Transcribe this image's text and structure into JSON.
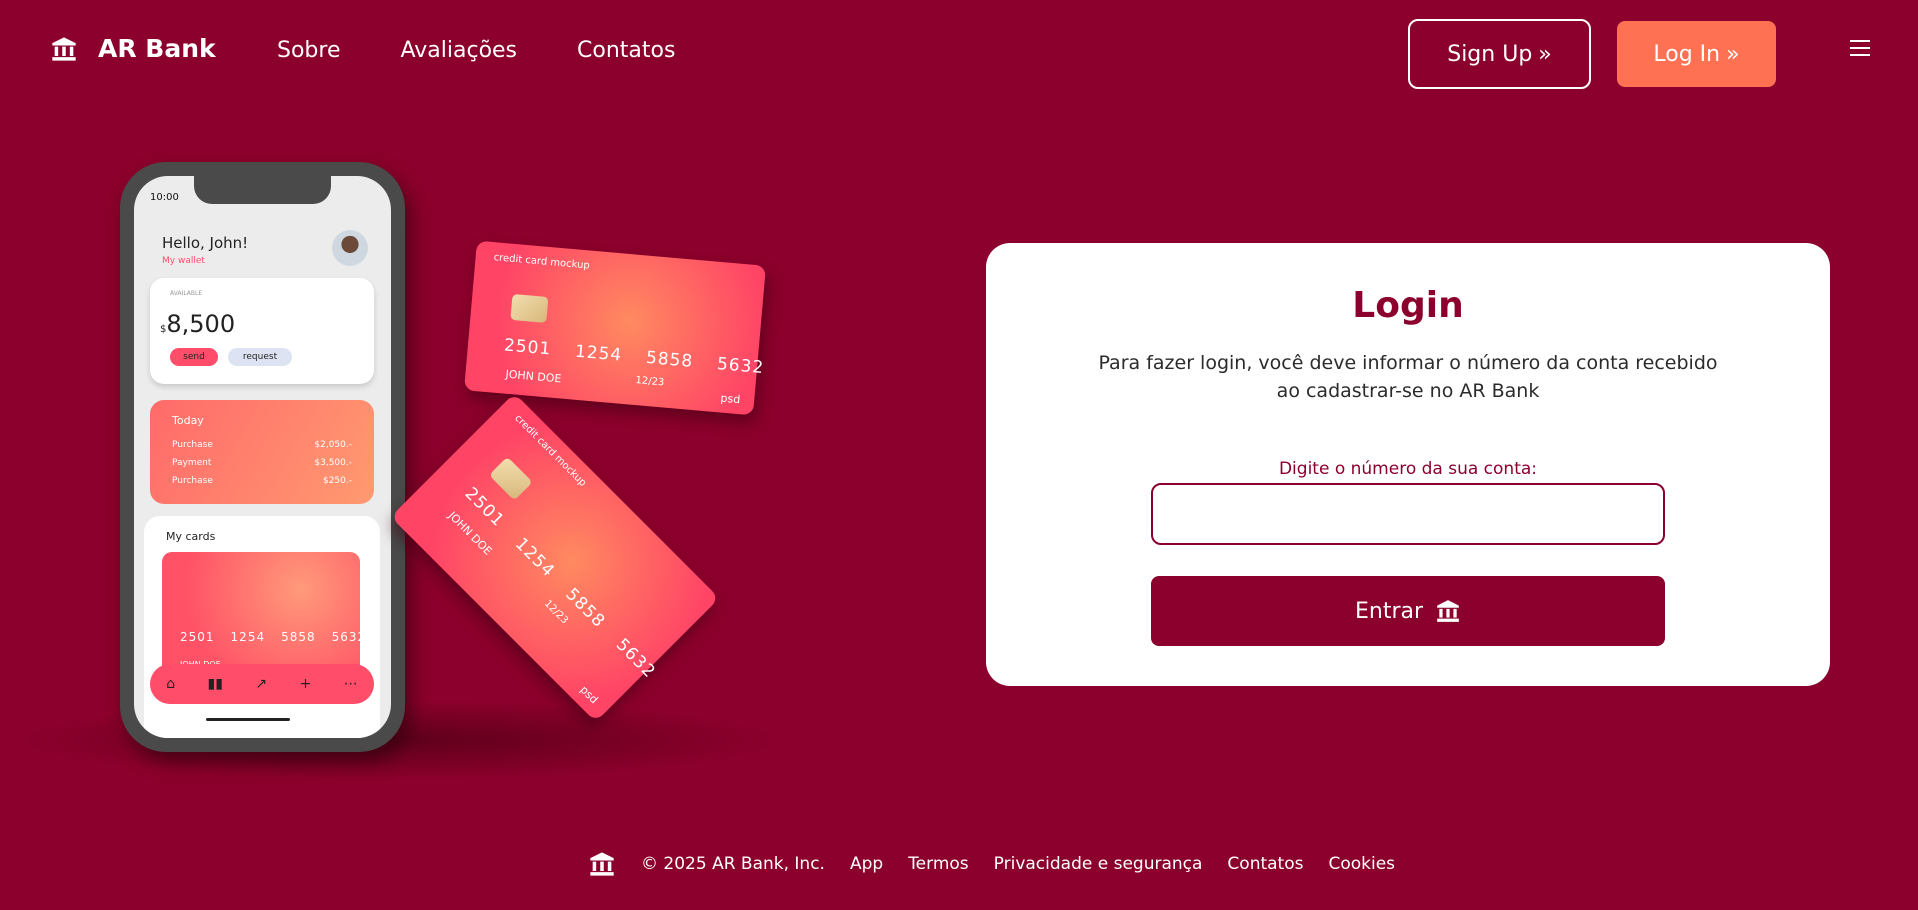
{
  "header": {
    "brand_name": "AR Bank",
    "brand_icon": "bank-icon",
    "nav": [
      "Sobre",
      "Avaliações",
      "Contatos"
    ],
    "signup_label": "Sign Up",
    "login_label": "Log In",
    "menu_icon": "hamburger-icon"
  },
  "illustration": {
    "phone": {
      "time": "10:00",
      "greeting": "Hello, John!",
      "wallet_label": "My wallet",
      "available_label": "AVAILABLE",
      "currency": "$",
      "balance": "8,500",
      "send_label": "send",
      "request_label": "request",
      "today_title": "Today",
      "transactions": [
        {
          "label": "Purchase",
          "amount": "$2,050.-"
        },
        {
          "label": "Payment",
          "amount": "$3,500.-"
        },
        {
          "label": "Purchase",
          "amount": "$250.-"
        }
      ],
      "my_cards_title": "My cards",
      "nav_icons": [
        "⌂",
        "▮▮",
        "↗",
        "+",
        "⋯"
      ]
    },
    "card": {
      "label": "credit card mockup",
      "number_groups": [
        "2501",
        "1254",
        "5858",
        "5632"
      ],
      "expiry": "12/23",
      "holder": "JOHN DOE",
      "brand": "psd"
    }
  },
  "login": {
    "title": "Login",
    "description": "Para fazer login, você deve informar o número da conta recebido ao cadastrar-se no AR Bank",
    "field_label": "Digite o número da sua conta:",
    "input_value": "",
    "button_label": "Entrar"
  },
  "footer": {
    "copyright": "© 2025 AR Bank, Inc.",
    "links": [
      "App",
      "Termos",
      "Privacidade e segurança",
      "Contatos",
      "Cookies"
    ]
  },
  "colors": {
    "background": "#8b002c",
    "accent": "#ff7152",
    "panel": "#ffffff"
  }
}
